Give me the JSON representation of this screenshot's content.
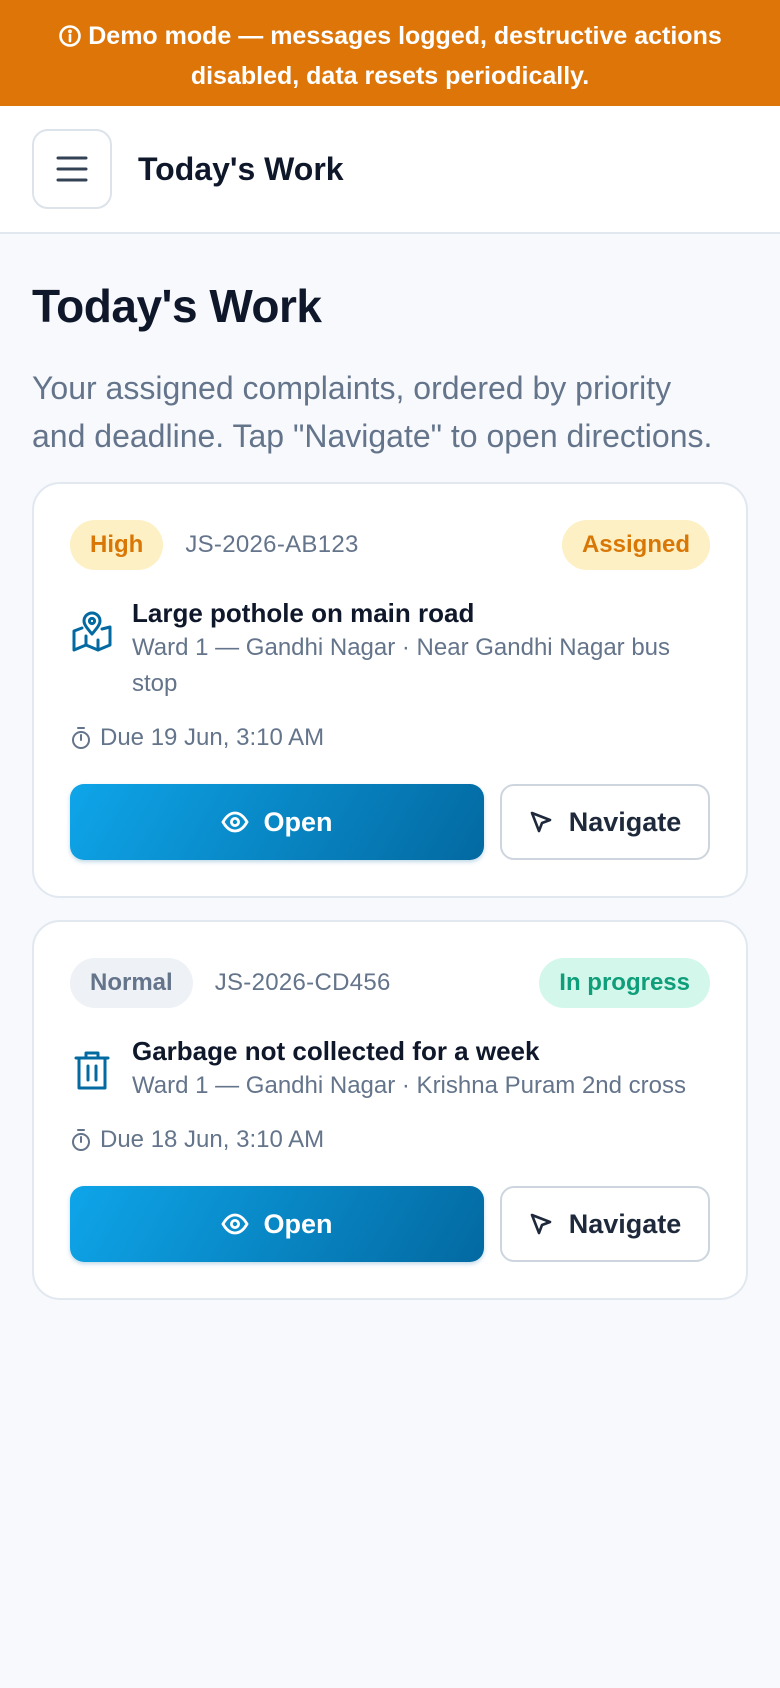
{
  "banner": {
    "icon": "info-icon",
    "text": "Demo mode — messages logged, destructive actions disabled, data resets periodically."
  },
  "header": {
    "menu_icon": "hamburger-menu-icon",
    "title": "Today's Work"
  },
  "page": {
    "title": "Today's Work",
    "description": "Your assigned complaints, ordered by priority and deadline. Tap \"Navigate\" to open directions."
  },
  "colors": {
    "banner_bg": "#de7508",
    "accent": "#0284c7",
    "high_priority": "#d97706",
    "in_progress": "#0f9e7a"
  },
  "complaints": [
    {
      "priority": "High",
      "code": "JS-2026-AB123",
      "status": "Assigned",
      "category_icon": "map-pin-icon",
      "title": "Large pothole on main road",
      "location": "Ward 1 — Gandhi Nagar · Near Gandhi Nagar bus stop",
      "due": "Due 19 Jun, 3:10 AM",
      "open_label": "Open",
      "navigate_label": "Navigate"
    },
    {
      "priority": "Normal",
      "code": "JS-2026-CD456",
      "status": "In progress",
      "category_icon": "trash-icon",
      "title": "Garbage not collected for a week",
      "location": "Ward 1 — Gandhi Nagar · Krishna Puram 2nd cross",
      "due": "Due 18 Jun, 3:10 AM",
      "open_label": "Open",
      "navigate_label": "Navigate"
    }
  ]
}
